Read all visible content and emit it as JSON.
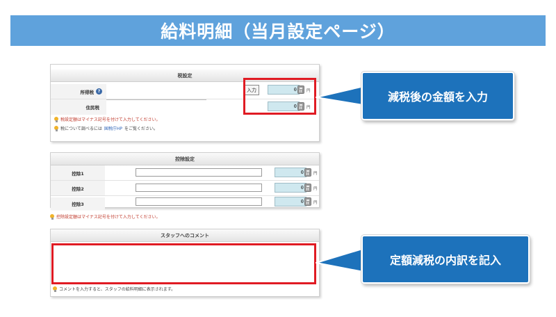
{
  "banner": {
    "title": "給料明細（当月設定ページ）"
  },
  "tax_panel": {
    "header": "税設定",
    "rows": [
      {
        "label": "所得税",
        "amount": "0",
        "unit": "円",
        "input_button": "入力"
      },
      {
        "label": "住民税",
        "amount": "0",
        "unit": "円"
      }
    ],
    "notes": [
      "税設定額はマイナス記号を付けて入力してください。",
      "税について調べるには",
      "国税庁HP",
      "をご覧ください。"
    ]
  },
  "deduction_panel": {
    "header": "控除設定",
    "rows": [
      {
        "label": "控除1",
        "amount": "0",
        "unit": "円"
      },
      {
        "label": "控除2",
        "amount": "0",
        "unit": "円"
      },
      {
        "label": "控除3",
        "amount": "0",
        "unit": "円"
      }
    ],
    "note": "控除設定額はマイナス記号を付けて入力してください。"
  },
  "comment_panel": {
    "header": "スタッフへのコメント",
    "note": "コメントを入力すると、スタッフの給料明細に表示されます。"
  },
  "callouts": {
    "tax_amount": "減税後の金額を入力",
    "comment": "定額減税の内訳を記入"
  },
  "colors": {
    "banner": "#5fa2dc",
    "callout": "#1d72bb",
    "highlight": "#e01b23",
    "amount_field": "#cfe8ef"
  },
  "icons": [
    "help-icon",
    "calculator-icon",
    "lightbulb-icon"
  ]
}
